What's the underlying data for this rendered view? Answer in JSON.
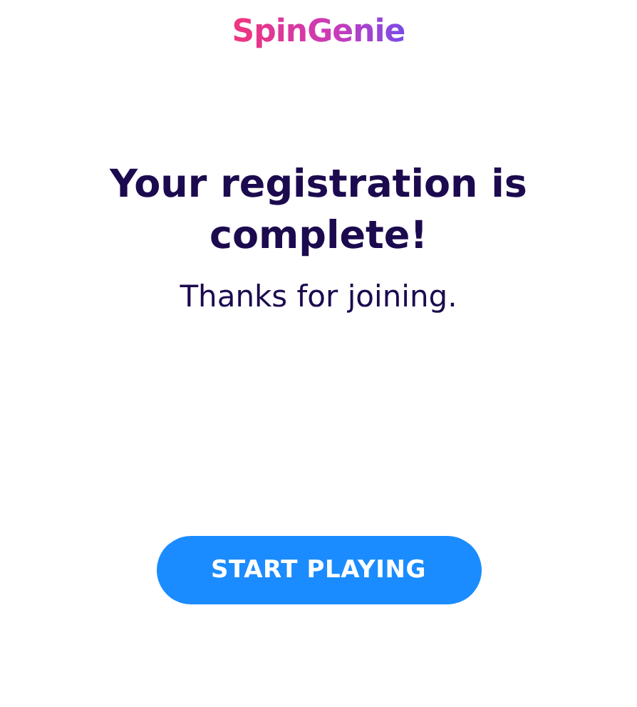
{
  "logo": {
    "text": "SpinGenie"
  },
  "heading": "Your registration is complete!",
  "subtitle": "Thanks for joining.",
  "button": {
    "label": "START PLAYING"
  }
}
